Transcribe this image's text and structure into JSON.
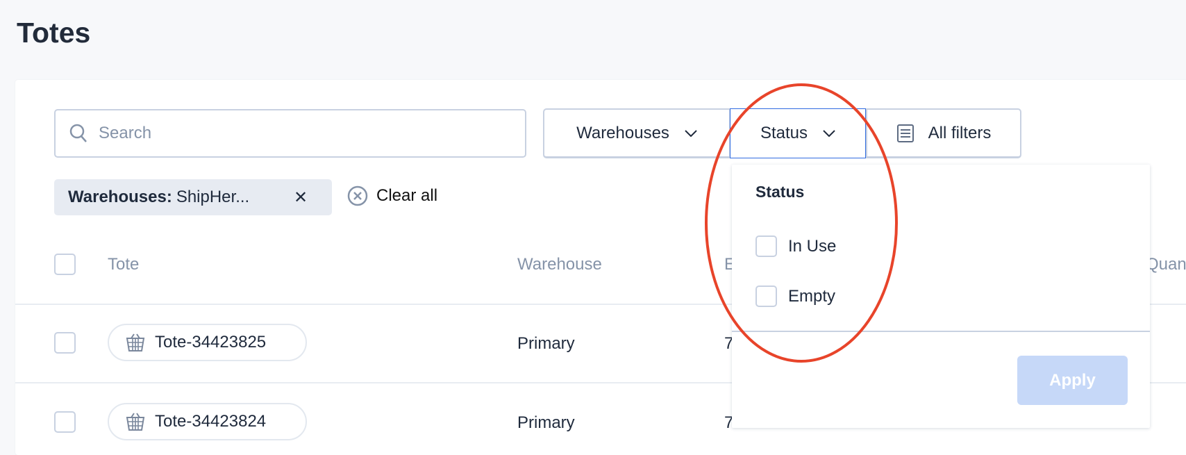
{
  "page": {
    "title": "Totes"
  },
  "toolbar": {
    "search_placeholder": "Search",
    "warehouses_label": "Warehouses",
    "status_label": "Status",
    "all_filters_label": "All filters"
  },
  "active_filters": {
    "chip_key": "Warehouses:",
    "chip_value": "ShipHer...",
    "clear_all": "Clear all"
  },
  "table": {
    "headers": [
      "Tote",
      "Warehouse",
      "E",
      "Quan"
    ],
    "rows": [
      {
        "tote": "Tote-34423825",
        "warehouse": "Primary",
        "col3": "7"
      },
      {
        "tote": "Tote-34423824",
        "warehouse": "Primary",
        "col3": "7"
      }
    ]
  },
  "status_dropdown": {
    "heading": "Status",
    "options": [
      {
        "label": "In Use",
        "checked": false
      },
      {
        "label": "Empty",
        "checked": false
      }
    ],
    "apply_label": "Apply"
  },
  "colors": {
    "accent": "#2f6be0",
    "apply_disabled": "#c6d8f8",
    "annotation": "#e8442a"
  }
}
